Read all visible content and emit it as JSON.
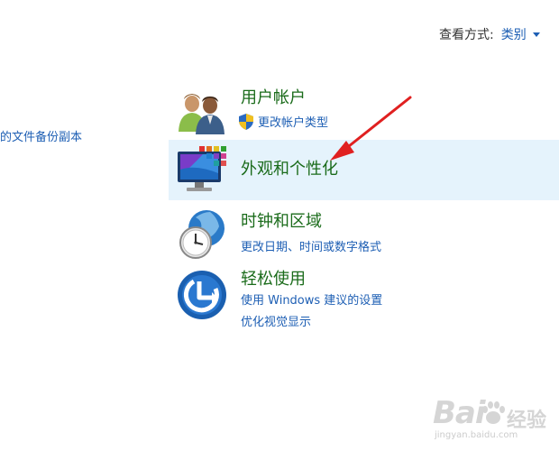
{
  "header": {
    "view_by_label": "查看方式:",
    "view_by_value": "类别"
  },
  "left_panel": {
    "partial_link": "的文件备份副本"
  },
  "categories": {
    "user_accounts": {
      "title": "用户帐户",
      "links": [
        "更改帐户类型"
      ],
      "icon": "users-icon"
    },
    "appearance": {
      "title": "外观和个性化",
      "icon": "display-personalization-icon",
      "highlighted": true
    },
    "clock_region": {
      "title": "时钟和区域",
      "links": [
        "更改日期、时间或数字格式"
      ],
      "icon": "clock-globe-icon"
    },
    "ease_of_access": {
      "title": "轻松使用",
      "links": [
        "使用 Windows 建议的设置",
        "优化视觉显示"
      ],
      "icon": "ease-of-access-icon"
    }
  },
  "watermark": {
    "logo": "Bai",
    "cn": "经验",
    "sub": "jingyan.baidu.com"
  },
  "colors": {
    "link": "#1e5fb4",
    "category_title": "#1a6b1a",
    "highlight_bg": "#e5f3fc",
    "arrow": "#e02020"
  }
}
